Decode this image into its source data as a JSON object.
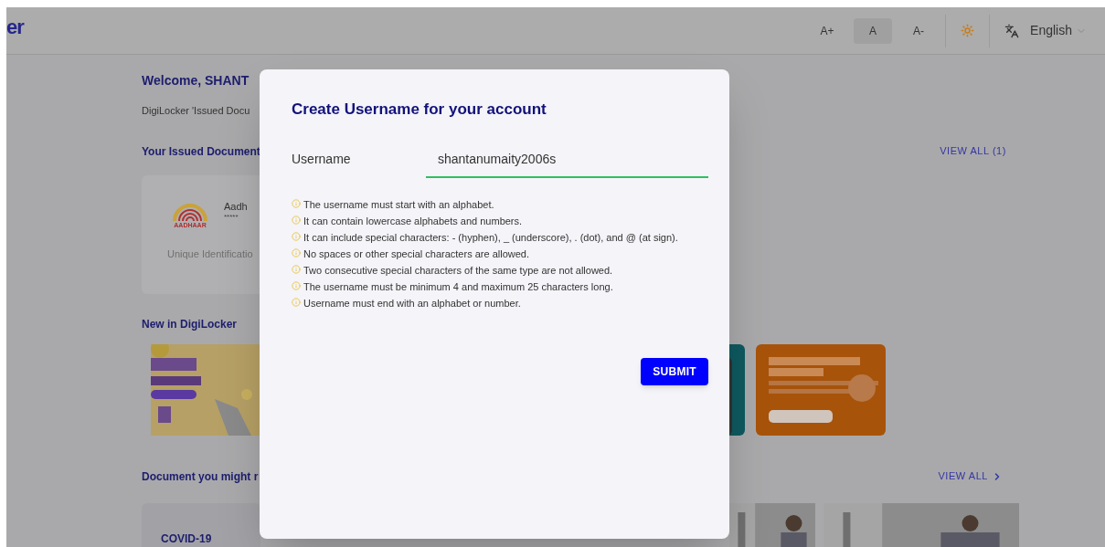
{
  "header": {
    "logo_text": "er",
    "font_controls": [
      {
        "label": "A+",
        "selected": false
      },
      {
        "label": "A",
        "selected": true
      },
      {
        "label": "A-",
        "selected": false
      }
    ],
    "language": "English"
  },
  "page": {
    "welcome": "Welcome, SHANT",
    "intro": "DigiLocker 'Issued Docu",
    "issued_heading": "Your Issued Document",
    "issued_view_all": "VIEW ALL (1)",
    "issued_card": {
      "logo_text": "AADHAAR",
      "title": "Aadh",
      "masked": "*****",
      "caption": "Unique Identificatio"
    },
    "new_heading": "New in DigiLocker",
    "suggest_heading": "Document you might r",
    "suggest_view_all": "VIEW ALL",
    "suggest_card": {
      "title": "COVID-19"
    }
  },
  "dialog": {
    "title": "Create Username for your account",
    "field_label": "Username",
    "field_value": "shantanumaity2006s",
    "rules": [
      "The username must start with an alphabet.",
      "It can contain lowercase alphabets and numbers.",
      "It can include special characters: - (hyphen), _ (underscore), . (dot), and @ (at sign).",
      "No spaces or other special characters are allowed.",
      "Two consecutive special characters of the same type are not allowed.",
      "The username must be minimum 4 and maximum 25 characters long.",
      "Username must end with an alphabet or number."
    ],
    "submit": "SUBMIT"
  }
}
